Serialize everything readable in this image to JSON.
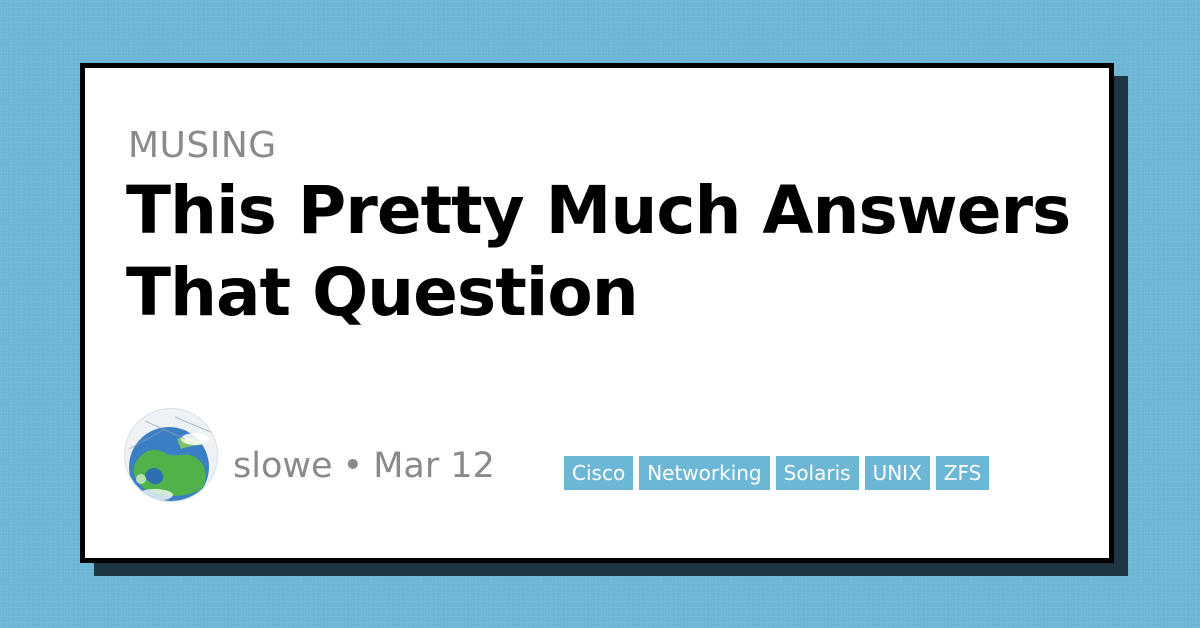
{
  "post": {
    "category": "MUSING",
    "title": "This Pretty Much Answers That Question",
    "author": "slowe",
    "separator": "•",
    "date": "Mar 12",
    "tags": [
      "Cisco",
      "Networking",
      "Solaris",
      "UNIX",
      "ZFS"
    ]
  },
  "colors": {
    "background": "#6cb6d6",
    "card": "#ffffff",
    "border": "#000000",
    "shadow": "#1e3544",
    "tag_bg": "#6cb6d6",
    "muted_text": "#8a8a8a"
  },
  "icons": {
    "avatar": "globe-cartoon-avatar"
  }
}
